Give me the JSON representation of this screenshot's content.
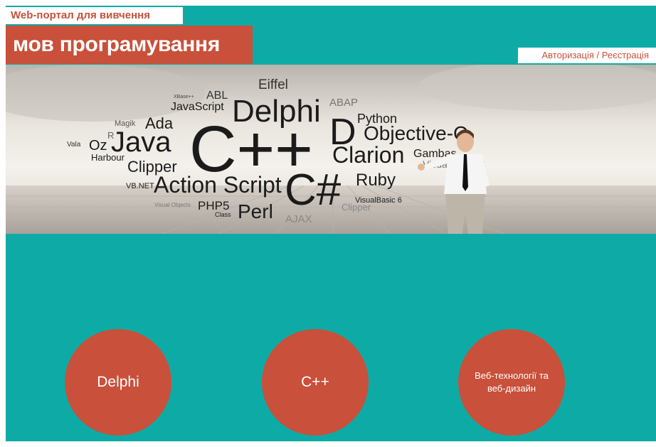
{
  "header": {
    "subtitle": "Web-портал для вивчення",
    "title": "мов програмування",
    "auth_link": "Авторизація / Реєстрація"
  },
  "banner": {
    "words": [
      "Eiffel",
      "ABL",
      "XBase++",
      "JavaScript",
      "Delphi",
      "ABAP",
      "Magik",
      "Ada",
      "R",
      "Python",
      "D",
      "Objective-C",
      "Vala",
      "Oz",
      "Java",
      "C++",
      "Clarion",
      "Gambas",
      "Harbour",
      "Clipper",
      "Visual Basic 6",
      "VB.NET",
      "Action Script",
      "C#",
      "Ruby",
      "VisualBasic 6",
      "Visual Objects",
      "PHP5",
      "Class",
      "Perl",
      "AJAX",
      "Clipper"
    ]
  },
  "courses": [
    {
      "label": "Delphi"
    },
    {
      "label": "C++"
    },
    {
      "label": "Веб-технології та веб-дизайн"
    }
  ],
  "colors": {
    "background": "#0eaba6",
    "accent": "#c9503a",
    "white": "#ffffff"
  }
}
